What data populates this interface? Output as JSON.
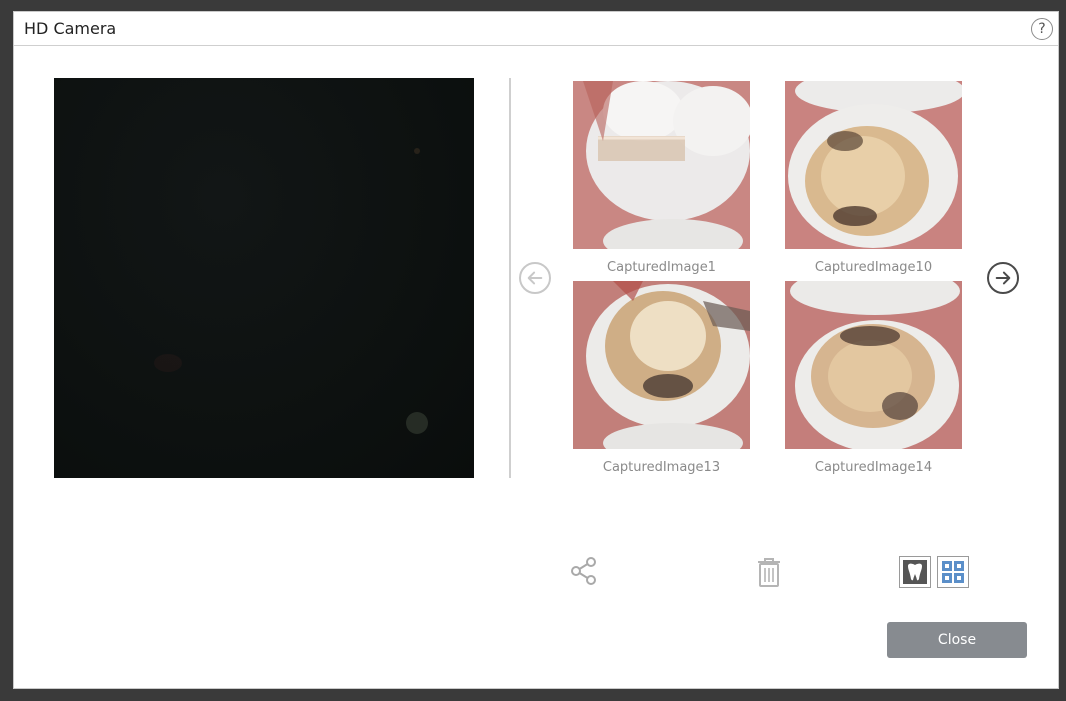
{
  "window": {
    "title": "HD Camera",
    "help_glyph": "?"
  },
  "gallery": {
    "thumbnails": [
      {
        "caption": "CapturedImage1"
      },
      {
        "caption": "CapturedImage10"
      },
      {
        "caption": "CapturedImage13"
      },
      {
        "caption": "CapturedImage14"
      }
    ],
    "prev_icon": "arrow-left-icon",
    "next_icon": "arrow-right-icon"
  },
  "toolbar": {
    "share_icon": "share-icon",
    "delete_icon": "trash-icon",
    "single_view_icon": "tooth-icon",
    "grid_view_icon": "grid-icon"
  },
  "footer": {
    "close_label": "Close"
  },
  "colors": {
    "close_button": "#878b90",
    "arrow_active": "#4a4a4a",
    "arrow_disabled": "#c8c8c8",
    "grid_icon_accent": "#5b8fc9"
  }
}
